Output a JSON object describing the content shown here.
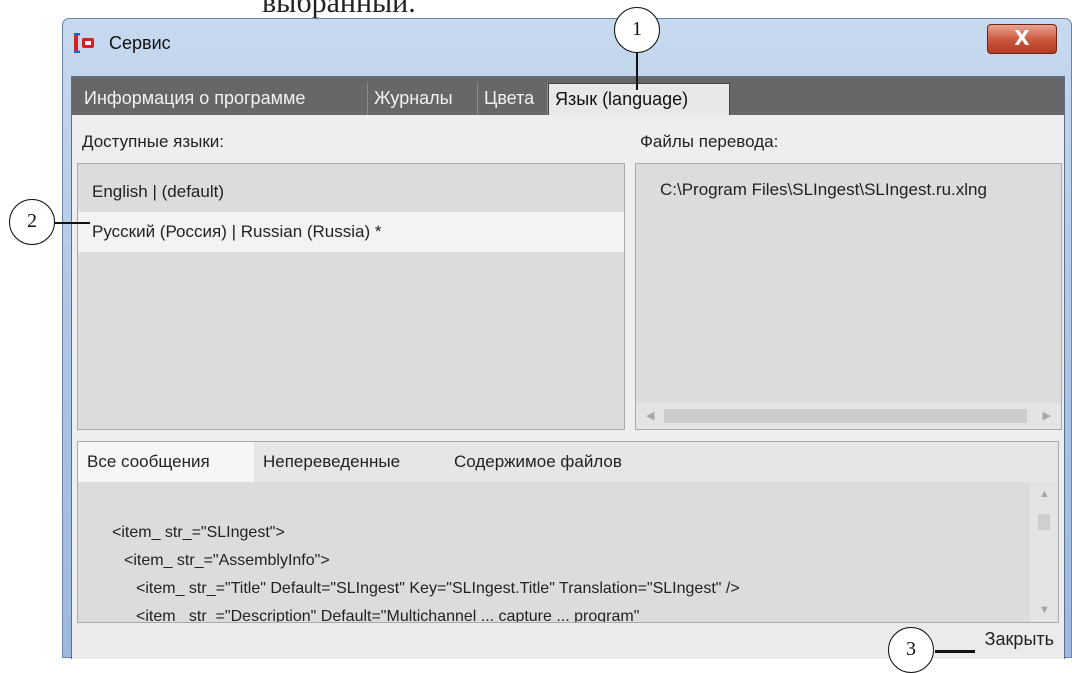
{
  "document": {
    "header_text": "выбранный."
  },
  "window": {
    "title": "Сервис",
    "close_glyph": "X",
    "icons": {
      "app": "app-logo-icon",
      "close": "close-icon"
    }
  },
  "tabs": [
    {
      "label": "Информация о программе",
      "active": false
    },
    {
      "label": "Журналы",
      "active": false
    },
    {
      "label": "Цвета",
      "active": false
    },
    {
      "label": "Язык (language)",
      "active": true
    }
  ],
  "languages": {
    "label": "Доступные языки:",
    "items": [
      {
        "label": "English | (default)",
        "selected": false
      },
      {
        "label": "Русский (Россия) | Russian (Russia)   *",
        "selected": true
      }
    ]
  },
  "translation_files": {
    "label": "Файлы перевода:",
    "items": [
      "C:\\Program Files\\SLIngest\\SLIngest.ru.xlng"
    ]
  },
  "message_tabs": [
    {
      "label": "Все сообщения",
      "active": true
    },
    {
      "label": "Непереведенные",
      "active": false
    },
    {
      "label": "Содержимое файлов",
      "active": false
    }
  ],
  "content_lines": [
    "<item_ str_=\"SLIngest\">",
    "<item_ str_=\"AssemblyInfo\">",
    "<item_ str_=\"Title\" Default=\"SLIngest\" Key=\"SLIngest.Title\" Translation=\"SLIngest\" />",
    "<item_ str_=\"Description\" Default=\"Multichannel ... capture ... program\""
  ],
  "footer": {
    "close_label": "Закрыть"
  },
  "callouts": [
    "1",
    "2",
    "3"
  ],
  "colors": {
    "tabstrip": "#676767",
    "close_button": "#c9553b",
    "selected_item": "#f3f3f3"
  }
}
